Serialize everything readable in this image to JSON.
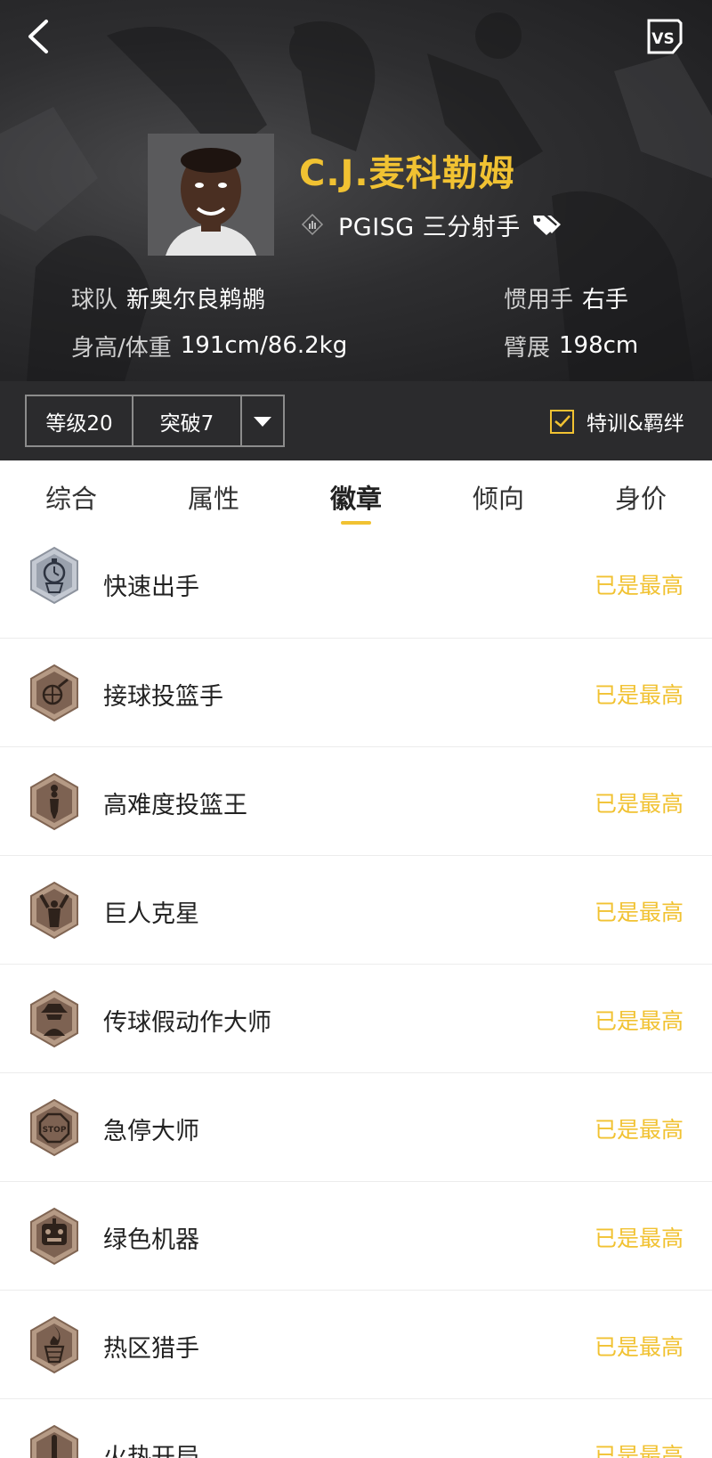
{
  "player": {
    "name": "C.J.麦科勒姆",
    "position_line": "PGISG 三分射手",
    "team_label": "球队",
    "team": "新奥尔良鹈鹕",
    "hand_label": "惯用手",
    "hand": "右手",
    "body_label": "身高/体重",
    "body": "191cm/86.2kg",
    "wingspan_label": "臂展",
    "wingspan": "198cm"
  },
  "level_bar": {
    "level": "等级20",
    "breakthrough": "突破7",
    "training_label": "特训&羁绊",
    "training_checked": true
  },
  "tabs": [
    {
      "label": "综合",
      "active": false
    },
    {
      "label": "属性",
      "active": false
    },
    {
      "label": "徽章",
      "active": true
    },
    {
      "label": "倾向",
      "active": false
    },
    {
      "label": "身价",
      "active": false
    }
  ],
  "badges": [
    {
      "name": "快速出手",
      "status": "已是最高",
      "icon": "stopwatch-hoop-icon",
      "tier": "silver"
    },
    {
      "name": "接球投篮手",
      "status": "已是最高",
      "icon": "catch-shoot-icon",
      "tier": "bronze"
    },
    {
      "name": "高难度投篮王",
      "status": "已是最高",
      "icon": "fadeaway-shooter-icon",
      "tier": "bronze"
    },
    {
      "name": "巨人克星",
      "status": "已是最高",
      "icon": "giant-slayer-icon",
      "tier": "bronze"
    },
    {
      "name": "传球假动作大师",
      "status": "已是最高",
      "icon": "spy-hat-icon",
      "tier": "bronze"
    },
    {
      "name": "急停大师",
      "status": "已是最高",
      "icon": "stop-sign-icon",
      "tier": "bronze"
    },
    {
      "name": "绿色机器",
      "status": "已是最高",
      "icon": "robot-icon",
      "tier": "bronze"
    },
    {
      "name": "热区猎手",
      "status": "已是最高",
      "icon": "flame-hoop-icon",
      "tier": "bronze"
    },
    {
      "name": "火热开局",
      "status": "已是最高",
      "icon": "thermometer-icon",
      "tier": "bronze"
    }
  ],
  "colors": {
    "accent": "#f1c232",
    "hero_bg": "#2e2e30",
    "level_bar_bg": "#2b2b2d"
  }
}
